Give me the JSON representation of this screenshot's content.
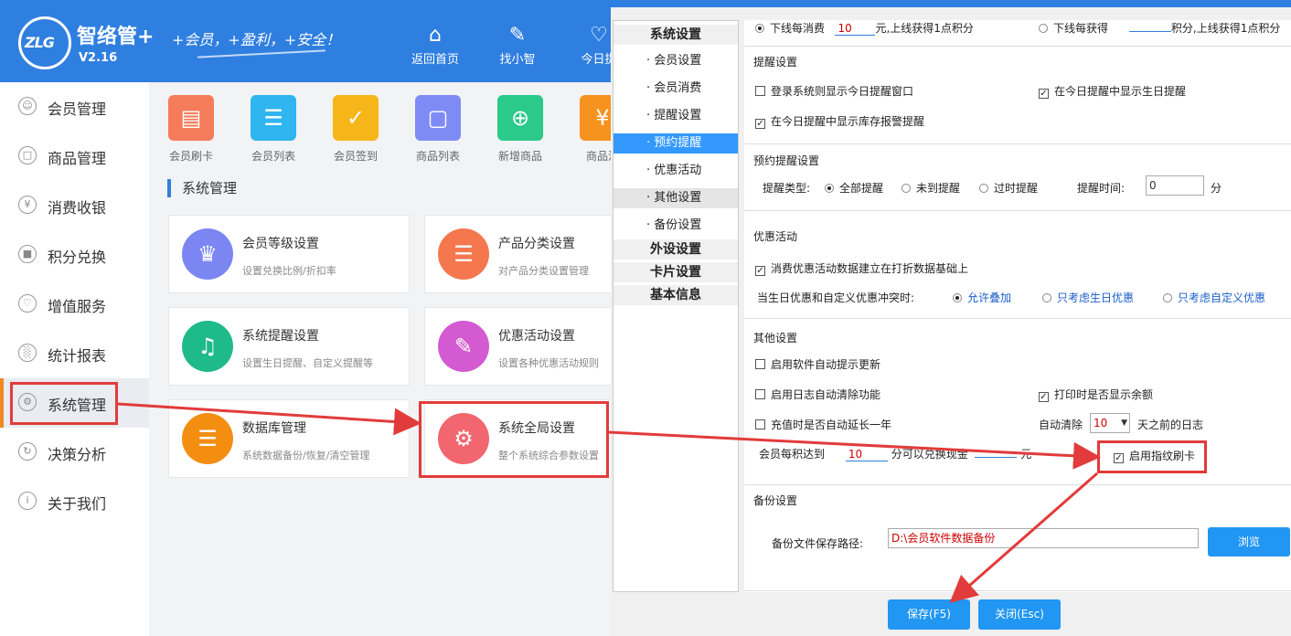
{
  "app": {
    "name": "智络管+",
    "version": "V2.16",
    "slogan": "+会员，+盈利，+安全！",
    "logo_text": "ZLG"
  },
  "top_nav": [
    {
      "label": "返回首页",
      "icon": "home-icon"
    },
    {
      "label": "找小智",
      "icon": "edit-icon"
    },
    {
      "label": "今日提",
      "icon": "bell-icon"
    }
  ],
  "sidebar": [
    {
      "label": "会员管理",
      "icon": "user-icon"
    },
    {
      "label": "商品管理",
      "icon": "bag-icon"
    },
    {
      "label": "消费收银",
      "icon": "yen-icon"
    },
    {
      "label": "积分兑换",
      "icon": "gift-icon"
    },
    {
      "label": "增值服务",
      "icon": "heart-icon"
    },
    {
      "label": "统计报表",
      "icon": "chart-icon"
    },
    {
      "label": "系统管理",
      "icon": "gear-icon",
      "active": true
    },
    {
      "label": "决策分析",
      "icon": "refresh-icon"
    },
    {
      "label": "关于我们",
      "icon": "info-icon"
    }
  ],
  "quick_items": [
    {
      "label": "会员刷卡",
      "color": "#f57c5a",
      "glyph": "⌂"
    },
    {
      "label": "会员列表",
      "color": "#2fb6f0",
      "glyph": "☰"
    },
    {
      "label": "会员签到",
      "color": "#f6b619",
      "glyph": "✔"
    },
    {
      "label": "商品列表",
      "color": "#7f8bf5",
      "glyph": "▢"
    },
    {
      "label": "新增商品",
      "color": "#2bc98a",
      "glyph": "⊕"
    },
    {
      "label": "商品消",
      "color": "#f6921e",
      "glyph": "¥"
    }
  ],
  "section_title": "系统管理",
  "cards": [
    {
      "title": "会员等级设置",
      "desc": "设置兑换比例/折扣率",
      "color": "#7b86f3",
      "glyph": "♛"
    },
    {
      "title": "产品分类设置",
      "desc": "对产品分类设置管理",
      "color": "#f5774e",
      "glyph": "☰"
    },
    {
      "title": "系统提醒设置",
      "desc": "设置生日提醒、自定义提醒等",
      "color": "#1fba8a",
      "glyph": "⍾"
    },
    {
      "title": "优惠活动设置",
      "desc": "设置各种优惠活动规则",
      "color": "#d35ad0",
      "glyph": "✐"
    },
    {
      "title": "数据库管理",
      "desc": "系统数据备份/恢复/清空管理",
      "color": "#f38e11",
      "glyph": "⛁"
    },
    {
      "title": "系统全局设置",
      "desc": "整个系统综合参数设置",
      "color": "#f2666f",
      "glyph": "⚙"
    }
  ],
  "settings_nav": [
    {
      "label": "系统设置",
      "type": "head"
    },
    {
      "label": "· 会员设置",
      "type": "sub"
    },
    {
      "label": "· 会员消费",
      "type": "sub"
    },
    {
      "label": "· 提醒设置",
      "type": "sub"
    },
    {
      "label": "· 预约提醒",
      "type": "sub",
      "selected": true
    },
    {
      "label": "· 优惠活动",
      "type": "sub"
    },
    {
      "label": "· 其他设置",
      "type": "sub",
      "highlight": true
    },
    {
      "label": "· 备份设置",
      "type": "sub"
    },
    {
      "label": "外设设置",
      "type": "head"
    },
    {
      "label": "卡片设置",
      "type": "head"
    },
    {
      "label": "基本信息",
      "type": "head"
    }
  ],
  "points_row": {
    "left_prefix": "下线每消费",
    "left_value": "10",
    "left_suffix": "元,上线获得1点积分",
    "right_prefix": "下线每获得",
    "right_value": "",
    "right_suffix": "积分,上线获得1点积分"
  },
  "reminder": {
    "title": "提醒设置",
    "opt1": "登录系统则显示今日提醒窗口",
    "opt1_checked": false,
    "opt2": "在今日提醒中显示生日提醒",
    "opt2_checked": true,
    "opt3": "在今日提醒中显示库存报警提醒",
    "opt3_checked": true
  },
  "booking": {
    "title": "预约提醒设置",
    "type_label": "提醒类型:",
    "options": [
      "全部提醒",
      "未到提醒",
      "过时提醒"
    ],
    "selected": 0,
    "time_label": "提醒时间:",
    "time_value": "0",
    "unit": "分"
  },
  "promo": {
    "title": "优惠活动",
    "opt1": "消费优惠活动数据建立在打折数据基础上",
    "opt1_checked": true,
    "conflict_label": "当生日优惠和自定义优惠冲突时:",
    "options": [
      "允许叠加",
      "只考虑生日优惠",
      "只考虑自定义优惠"
    ],
    "selected": 0
  },
  "other": {
    "title": "其他设置",
    "auto_update": "启用软件自动提示更新",
    "auto_update_checked": false,
    "log_clean": "启用日志自动清除功能",
    "log_clean_checked": false,
    "print_balance": "打印时是否显示余额",
    "print_balance_checked": true,
    "extend_year": "充值时是否自动延长一年",
    "extend_year_checked": false,
    "auto_clear_label": "自动清除",
    "auto_clear_value": "10",
    "auto_clear_suffix": "天之前的日志",
    "exchange_prefix": "会员每积达到",
    "exchange_value": "10",
    "exchange_mid": "分可以兑换现金",
    "exchange_cash": "",
    "exchange_suffix": "元",
    "fingerprint": "启用指纹刷卡",
    "fingerprint_checked": true
  },
  "backup": {
    "title": "备份设置",
    "path_label": "备份文件保存路径:",
    "path_value": "D:\\会员软件数据备份",
    "browse": "浏览"
  },
  "buttons": {
    "save": "保存(F5)",
    "close": "关闭(Esc)"
  }
}
